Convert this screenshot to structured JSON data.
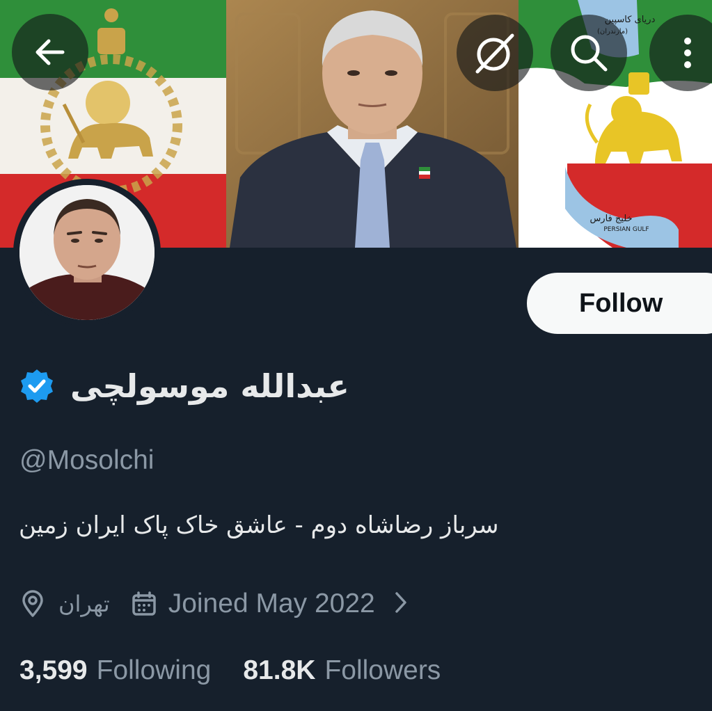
{
  "header": {
    "back_icon": "arrow-left-icon",
    "grok_icon": "grok-slash-icon",
    "search_icon": "search-icon",
    "more_icon": "more-vertical-icon"
  },
  "profile": {
    "display_name": "عبدالله موسولچی",
    "handle": "@Mosolchi",
    "bio": "سرباز رضاشاه دوم - عاشق خاک پاک ایران زمین",
    "location": "تهران",
    "joined": "Joined May 2022",
    "verified": true
  },
  "actions": {
    "follow_label": "Follow"
  },
  "stats": {
    "following_count": "3,599",
    "following_label": "Following",
    "followers_count": "81.8K",
    "followers_label": "Followers"
  },
  "banner": {
    "map_label_north": "دریای کاسپین",
    "map_label_north_sub": "(مازندران)",
    "map_label_gulf": "خلیج فارس",
    "map_label_gulf_en": "PERSIAN GULF"
  },
  "colors": {
    "background": "#16202c",
    "text_primary": "#e7e9ea",
    "text_secondary": "#8b98a5",
    "verified_blue": "#1d9bf0",
    "follow_bg": "#f7f9f9"
  }
}
